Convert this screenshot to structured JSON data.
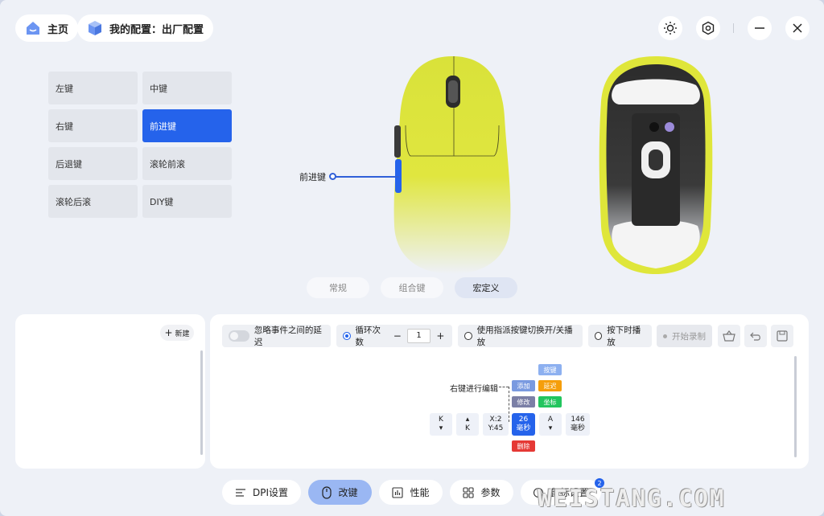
{
  "header": {
    "home_label": "主页",
    "config_label": "我的配置：出厂配置"
  },
  "keys": [
    {
      "label": "左键",
      "active": false
    },
    {
      "label": "中键",
      "active": false
    },
    {
      "label": "右键",
      "active": false
    },
    {
      "label": "前进键",
      "active": true
    },
    {
      "label": "后退键",
      "active": false
    },
    {
      "label": "滚轮前滚",
      "active": false
    },
    {
      "label": "滚轮后滚",
      "active": false
    },
    {
      "label": "DIY键",
      "active": false
    }
  ],
  "callout_label": "前进键",
  "mode_tabs": [
    {
      "label": "常规",
      "active": false
    },
    {
      "label": "组合键",
      "active": false
    },
    {
      "label": "宏定义",
      "active": true
    }
  ],
  "macro_list": {
    "new_label": "新建"
  },
  "toolbar": {
    "ignore_delay_label": "忽略事件之间的延迟",
    "loop_label": "循环次数",
    "loop_count": "1",
    "assign_toggle_label": "使用指派按键切换开/关播放",
    "hold_play_label": "按下时播放",
    "record_label": "开始录制"
  },
  "editor": {
    "hint_label": "右键进行编辑",
    "chips": {
      "key": "按键",
      "add": "添加",
      "delay": "延迟",
      "modify": "修改",
      "coord": "坐标",
      "delete": "删除"
    },
    "sequence": [
      {
        "top": "K",
        "bottom": "▾"
      },
      {
        "top": "▴",
        "bottom": "K"
      },
      {
        "top": "X:2",
        "bottom": "Y:45"
      },
      {
        "top": "26",
        "bottom": "毫秒"
      },
      {
        "top": "A",
        "bottom": "▾"
      },
      {
        "top": "146",
        "bottom": "毫秒"
      }
    ]
  },
  "bottom_nav": {
    "dpi": "DPI设置",
    "keys": "改键",
    "perf": "性能",
    "params": "参数",
    "mouse": "鼠标设置",
    "badge": "2"
  },
  "watermark": "WEISTANG.COM",
  "colors": {
    "accent": "#2563eb",
    "mouse_body": "#dfe63a",
    "delete": "#e53935",
    "delay": "#f59e0b",
    "coord": "#22c55e"
  }
}
